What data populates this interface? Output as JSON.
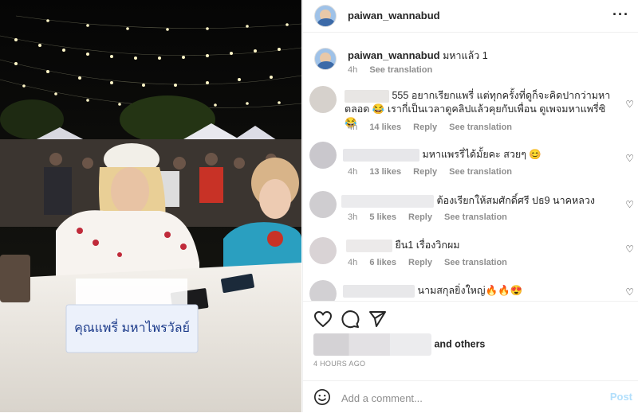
{
  "post": {
    "author": "paiwan_wannabud",
    "caption_text": "มหาแล้ว 1",
    "caption_time": "4h",
    "see_translation": "See translation",
    "more_icon": "more-horizontal-icon",
    "photo_sign_text": "คุณแพรี่ มหาไพรวัลย์"
  },
  "comments": [
    {
      "text": "555 อยากเรียกแพรี่ แต่ทุกครั้งที่ดูก็จะคิดปากว่ามหาตลอด 😂 เรากี่เป็นเวลาดูคลิปแล้วคุยกับเพื่อน ดูเพจมหาแพรี่ซิ 😂",
      "time": "4h",
      "likes": "14 likes",
      "reply": "Reply",
      "translate": "See translation"
    },
    {
      "text": "มหาแพรรี่ได้มั้ยคะ สวยๆ 😊",
      "time": "4h",
      "likes": "13 likes",
      "reply": "Reply",
      "translate": "See translation"
    },
    {
      "text": "ต้องเรียกให้สมศักดิ์ศรี ปธ9 นาคหลวง",
      "time": "3h",
      "likes": "5 likes",
      "reply": "Reply",
      "translate": "See translation"
    },
    {
      "text": "ยืน1 เรื่องวิกผม",
      "time": "4h",
      "likes": "6 likes",
      "reply": "Reply",
      "translate": "See translation"
    },
    {
      "text": "นามสกุลยิ่งใหญ่🔥🔥😍"
    }
  ],
  "actions": {
    "like_icon": "heart-icon",
    "comment_icon": "comment-icon",
    "share_icon": "send-icon"
  },
  "likes_suffix": "and others",
  "timestamp": "4 HOURS AGO",
  "add_comment": {
    "placeholder": "Add a comment...",
    "post_label": "Post",
    "emoji_icon": "emoji-icon"
  }
}
